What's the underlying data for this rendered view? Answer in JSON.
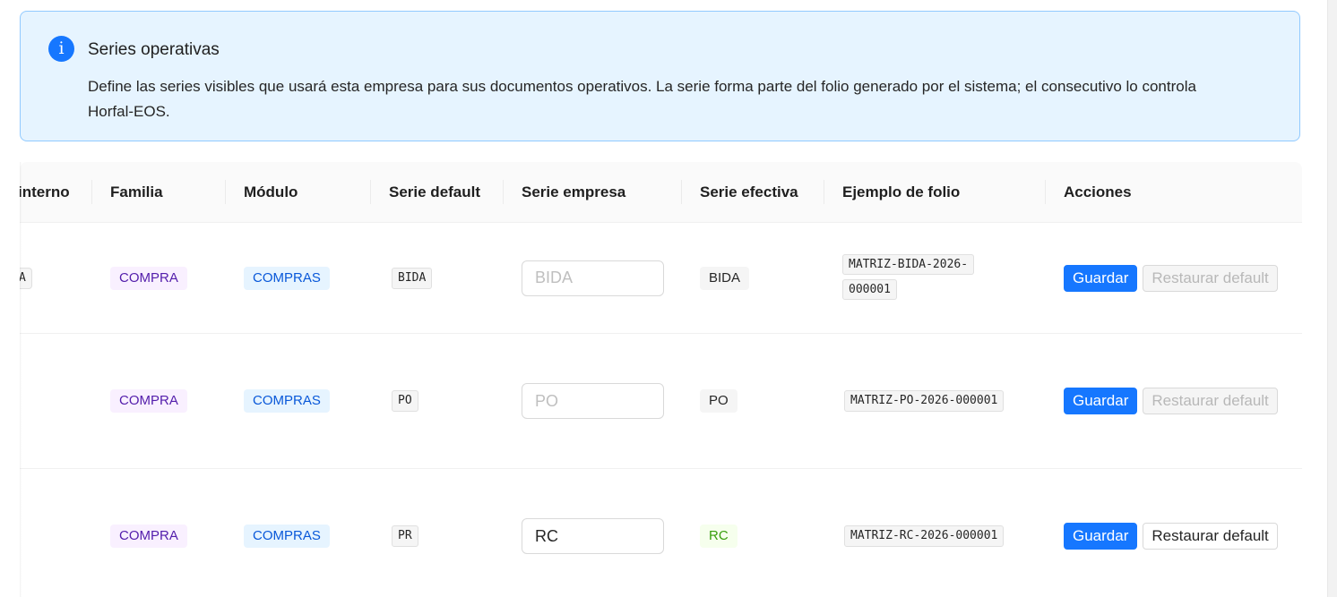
{
  "alert": {
    "title": "Series operativas",
    "description": "Define las series visibles que usará esta empresa para sus documentos operativos. La serie forma parte del folio generado por el sistema; el consecutivo lo controla Horfal-EOS.",
    "icon": "info-icon",
    "color": "#1677ff"
  },
  "table": {
    "columns": [
      "interno",
      "Familia",
      "Módulo",
      "Serie default",
      "Serie empresa",
      "Serie efectiva",
      "Ejemplo de folio",
      "Acciones"
    ],
    "rows": [
      {
        "interno_partial": "A",
        "familia": "COMPRA",
        "modulo": "COMPRAS",
        "serie_default": "BIDA",
        "serie_empresa_value": "",
        "serie_empresa_placeholder": "BIDA",
        "serie_efectiva": "BIDA",
        "folio_line1": "MATRIZ-BIDA-2026-",
        "folio_line2": "000001",
        "guardar": "Guardar",
        "restaurar": "Restaurar default",
        "restaurar_disabled": true
      },
      {
        "interno_partial": "",
        "familia": "COMPRA",
        "modulo": "COMPRAS",
        "serie_default": "PO",
        "serie_empresa_value": "",
        "serie_empresa_placeholder": "PO",
        "serie_efectiva": "PO",
        "folio": "MATRIZ-PO-2026-000001",
        "guardar": "Guardar",
        "restaurar": "Restaurar default",
        "restaurar_disabled": true
      },
      {
        "interno_partial": "",
        "familia": "COMPRA",
        "modulo": "COMPRAS",
        "serie_default": "PR",
        "serie_empresa_value": "RC",
        "serie_empresa_placeholder": "",
        "serie_efectiva": "RC",
        "folio": "MATRIZ-RC-2026-000001",
        "guardar": "Guardar",
        "restaurar": "Restaurar default",
        "restaurar_disabled": false
      }
    ]
  },
  "colors": {
    "primary": "#1677ff",
    "info_bg": "#e6f4ff",
    "info_border": "#91caff",
    "purple_tag": "#531dab",
    "blue_tag": "#0958d9",
    "green_tag": "#389e0d"
  }
}
